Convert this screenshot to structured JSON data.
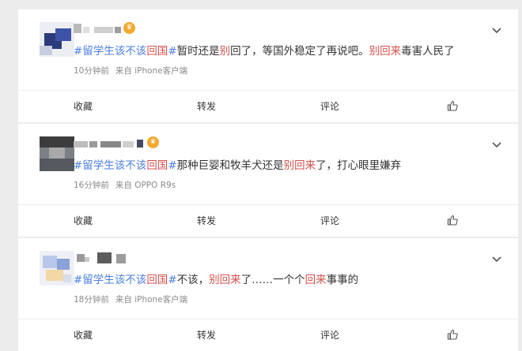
{
  "posts": [
    {
      "tag_prefix": "#留学生",
      "tag_mid": "该不该",
      "tag_hl": "回国",
      "tag_suffix": "#",
      "text_1": "暂时还是",
      "text_hl_1": "别",
      "text_2": "回了，等国外稳定了再说吧。",
      "text_hl_2": "别回来",
      "text_3": "毒害人民了",
      "time": "10分钟前",
      "source": "来自 iPhone客户端"
    },
    {
      "tag_prefix": "#留学生",
      "tag_mid": "该不该",
      "tag_hl": "回国",
      "tag_suffix": "#",
      "text_1": "那种巨婴和牧羊犬还是",
      "text_hl_1": "别回来",
      "text_2": "了，打心眼里嫌弃",
      "text_hl_2": "",
      "text_3": "",
      "time": "16分钟前",
      "source": "来自 OPPO R9s"
    },
    {
      "tag_prefix": "#留学生",
      "tag_mid": "该不该",
      "tag_hl": "回国",
      "tag_suffix": "#",
      "text_1": "不该，",
      "text_hl_1": "别回来",
      "text_2": "了……一个个",
      "text_hl_2": "回来",
      "text_3": "事事的",
      "time": "18分钟前",
      "source": "来自 iPhone客户端"
    }
  ],
  "actions": {
    "collect": "收藏",
    "forward": "转发",
    "comment": "评论"
  },
  "icons": {
    "crown": "crown-badge-icon",
    "chevron": "chevron-down-icon",
    "like": "thumbs-up-icon"
  },
  "colors": {
    "tag_blue": "#4a7ddf",
    "highlight_red": "#d6504c",
    "crown_orange": "#f3a82f"
  }
}
